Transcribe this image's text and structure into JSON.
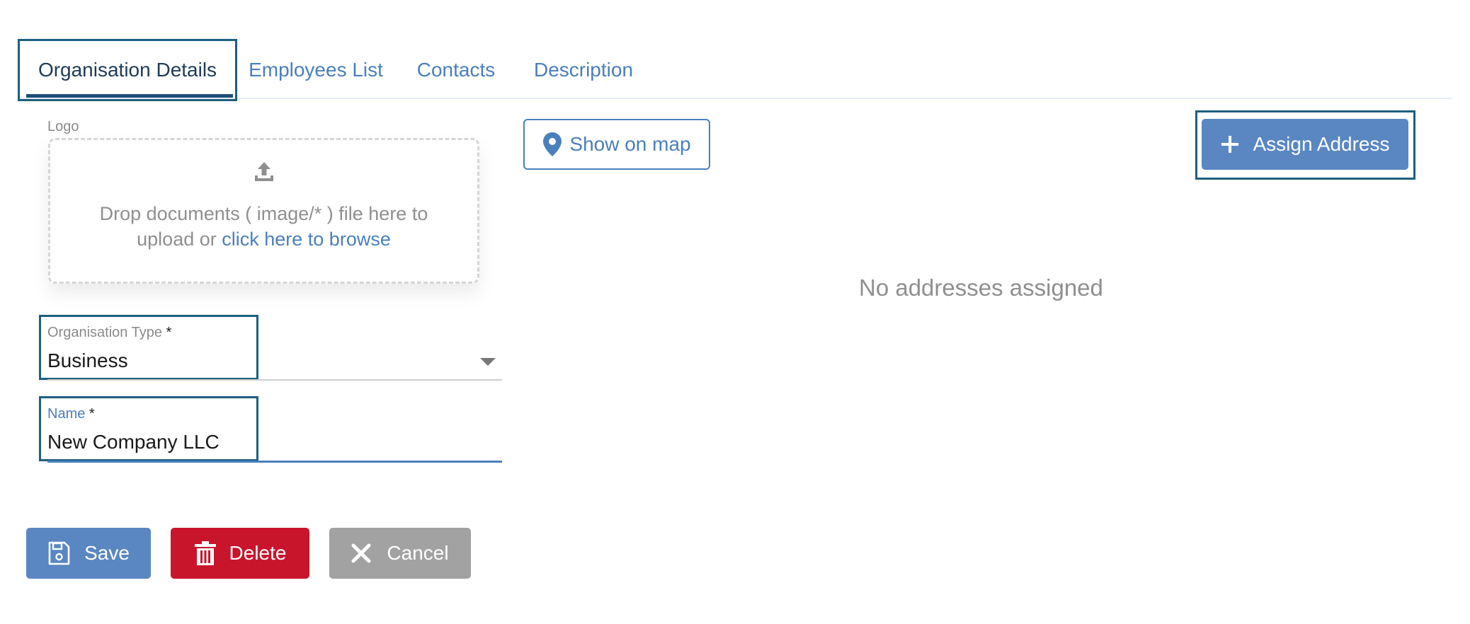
{
  "tabs": [
    {
      "label": "Organisation Details",
      "active": true
    },
    {
      "label": "Employees List",
      "active": false
    },
    {
      "label": "Contacts",
      "active": false
    },
    {
      "label": "Description",
      "active": false
    }
  ],
  "logo": {
    "label": "Logo",
    "drop_text": "Drop documents ( image/* ) file here to upload or",
    "browse_link": "click here to browse",
    "icon": "upload-icon"
  },
  "org_type": {
    "label": "Organisation Type",
    "required_mark": "*",
    "value": "Business",
    "icon": "chevron-down-icon"
  },
  "name_field": {
    "label": "Name",
    "required_mark": "*",
    "value": "New Company LLC"
  },
  "map_button": {
    "label": "Show on map",
    "icon": "map-pin-icon"
  },
  "assign_button": {
    "label": "Assign Address",
    "icon": "plus-icon"
  },
  "addresses": {
    "empty_message": "No addresses assigned"
  },
  "actions": {
    "save": {
      "label": "Save",
      "icon": "save-icon"
    },
    "delete": {
      "label": "Delete",
      "icon": "trash-icon"
    },
    "cancel": {
      "label": "Cancel",
      "icon": "close-icon"
    }
  },
  "colors": {
    "primary": "#5a87c2",
    "danger": "#c8152c",
    "neutral": "#a2a2a2",
    "focus_border": "#1d5f7e",
    "link": "#4a7fbd"
  }
}
